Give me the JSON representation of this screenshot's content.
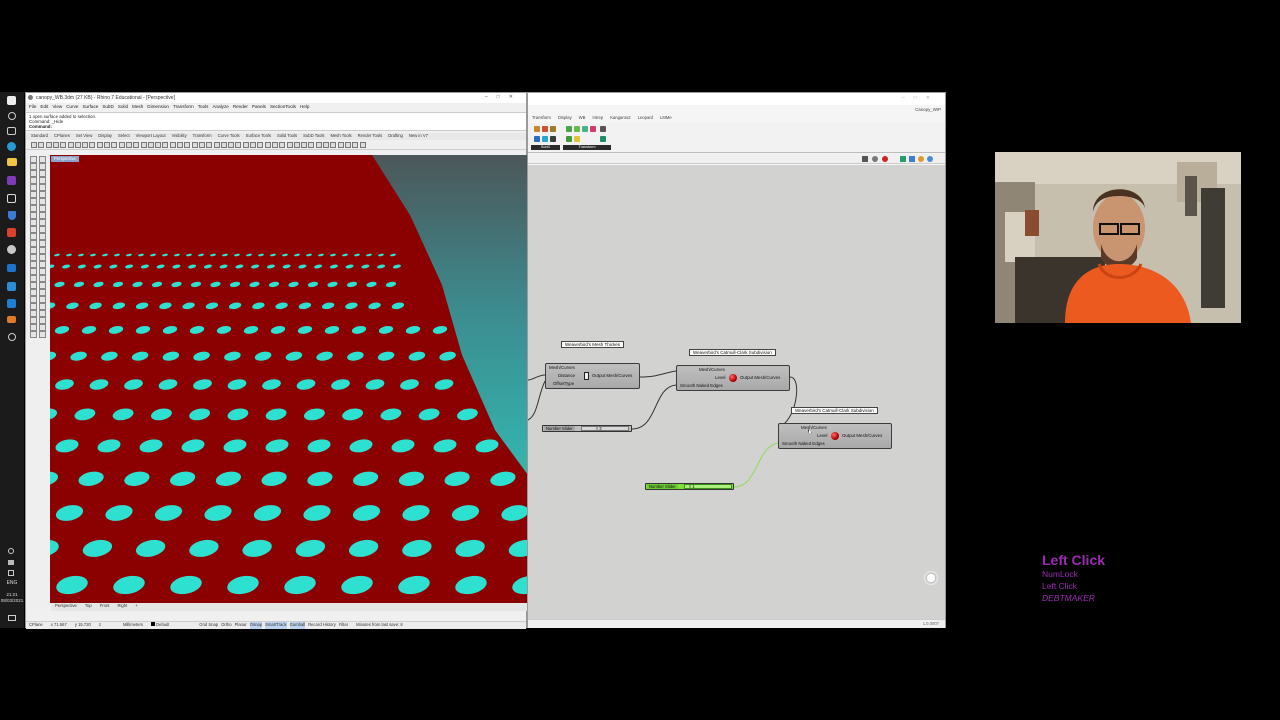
{
  "taskbar": {
    "icons": [
      "windows-icon",
      "search-icon",
      "task-view-icon",
      "edge-icon",
      "file-explorer-icon",
      "onenote-icon",
      "3d-viewer-icon",
      "defender-icon",
      "office-icon",
      "rhino-icon",
      "mail-icon",
      "grasshopper-icon",
      "outlook-icon",
      "edge-icon",
      "steam-icon",
      "settings-icon"
    ],
    "language": "ENG",
    "time": "21:21",
    "date": "08/03/2021"
  },
  "rhino": {
    "title": "canopy_WB.3dm (27 KB) - Rhino 7 Educational - [Perspective]",
    "menu": [
      "File",
      "Edit",
      "View",
      "Curve",
      "Surface",
      "SubD",
      "Solid",
      "Mesh",
      "Dimension",
      "Transform",
      "Tools",
      "Analyze",
      "Render",
      "Panels",
      "SectionTools",
      "Help"
    ],
    "command_lines": [
      "1 open surface added to selection.",
      "Command: _Hide",
      "Command:"
    ],
    "toolbar_tabs": [
      "Standard",
      "CPlanes",
      "Set View",
      "Display",
      "Select",
      "Viewport Layout",
      "Visibility",
      "Transform",
      "Curve Tools",
      "Surface Tools",
      "Solid Tools",
      "SubD Tools",
      "Mesh Tools",
      "Render Tools",
      "Drafting",
      "New in V7"
    ],
    "viewport_label": "Perspective",
    "viewport_tabs": [
      "Perspective",
      "Top",
      "Front",
      "Right",
      "+"
    ],
    "status": {
      "cplane": "CPlane",
      "x": "x 71.567",
      "y": "y 15.720",
      "z": "z",
      "units": "Millimeters",
      "layer": "Default",
      "toggles": [
        "Grid Snap",
        "Ortho",
        "Planar",
        "Osnap",
        "SmartTrack",
        "Gumball",
        "Record History",
        "Filter"
      ],
      "message": "Minutes from last save: 8"
    },
    "colors": {
      "surface": "#8b0000",
      "holes": "#2ee0cf",
      "background": "#3b9fa4"
    }
  },
  "grasshopper": {
    "title": "Canopy_WIP",
    "tabs": [
      "Transform",
      "Display",
      "WB",
      "Intrep",
      "Kangaroo2",
      "Leopard",
      "LMMe"
    ],
    "panels": [
      "SubD",
      "Transform"
    ],
    "components": {
      "mesh_thicken": {
        "tag": "Weaverbird's Mesh Thicken",
        "inputs": [
          "Mesh/Curves",
          "Distance",
          "OffsetType"
        ],
        "output": "Output Mesh/Curves"
      },
      "subdivision_1": {
        "tag": "Weaverbird's Catmull-Clark Subdivision",
        "inputs": [
          "Mesh/Curves",
          "Level",
          "Smooth Naked Edges"
        ],
        "output": "Output Mesh/Curves"
      },
      "subdivision_2": {
        "tag": "Weaverbird's Catmull-Clark Subdivision",
        "inputs": [
          "Mesh/Curves",
          "Level",
          "Smooth Naked Edges"
        ],
        "output": "Output Mesh/Curves"
      }
    },
    "sliders": [
      {
        "name": "Number Slider",
        "value": "◊ 3"
      },
      {
        "name": "Number Slider",
        "value": "◊ 1"
      }
    ],
    "version": "1.0.0007"
  },
  "key_overlay": {
    "main": "Left Click",
    "lines": [
      "NumLock",
      "Left Click"
    ],
    "credit": "DEBTMAKER",
    "color": "#9b2bb0"
  }
}
